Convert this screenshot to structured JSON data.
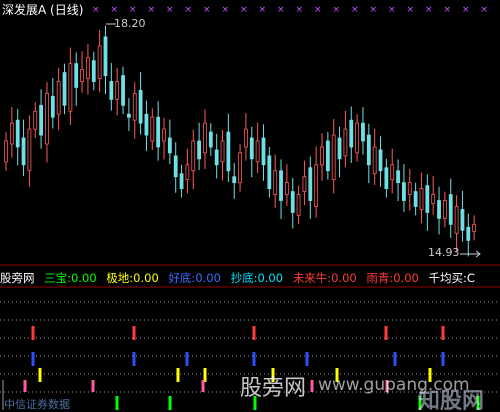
{
  "chart_title": "深发展A (日线)",
  "price_labels": {
    "high": "18.20",
    "low": "14.93"
  },
  "indicator_bar": {
    "name": "股旁网",
    "items": [
      {
        "label": "三宝:",
        "value": "0.00",
        "color": "#00ff00"
      },
      {
        "label": "极地:",
        "value": "0.00",
        "color": "#ffff00"
      },
      {
        "label": "好底:",
        "value": "0.00",
        "color": "#3a6cff"
      },
      {
        "label": "抄底:",
        "value": "0.00",
        "color": "#00e5ff"
      },
      {
        "label": "未来牛:",
        "value": "0.00",
        "color": "#ff3a3a"
      },
      {
        "label": "雨青:",
        "value": "0.00",
        "color": "#ff3a3a"
      },
      {
        "label": "千均买:",
        "value": "C",
        "color": "#ffffff"
      }
    ]
  },
  "watermark": {
    "cn": "股旁网",
    "url": "www.gupang.com",
    "logo": "知股网"
  },
  "bottom_text": "中信证券数据",
  "chart_data": {
    "type": "candlestick",
    "closes": [
      16.6,
      16.9,
      16.5,
      16.2,
      16.8,
      17.1,
      16.7,
      17.4,
      17.0,
      17.6,
      17.2,
      17.9,
      17.5,
      17.8,
      18.0,
      17.6,
      18.2,
      17.7,
      17.3,
      17.6,
      17.2,
      17.0,
      17.4,
      16.9,
      16.7,
      17.0,
      16.5,
      16.8,
      16.4,
      16.0,
      15.8,
      16.2,
      16.6,
      16.3,
      16.9,
      16.5,
      16.2,
      16.6,
      16.1,
      15.9,
      16.4,
      16.8,
      16.3,
      16.6,
      16.2,
      15.8,
      16.1,
      15.6,
      15.9,
      15.4,
      15.7,
      16.0,
      15.6,
      16.2,
      16.5,
      16.1,
      16.7,
      16.3,
      16.8,
      16.5,
      16.9,
      16.6,
      16.2,
      16.5,
      16.1,
      15.8,
      16.2,
      15.9,
      15.6,
      15.9,
      15.5,
      15.8,
      15.4,
      15.7,
      15.3,
      15.6,
      15.2,
      15.5,
      15.1,
      14.93,
      15.2
    ],
    "high": 18.2,
    "low": 14.93
  },
  "signals": [
    {
      "row": "red",
      "color": "#ff3a3a",
      "x": [
        33,
        134,
        254,
        386,
        443
      ]
    },
    {
      "row": "blue",
      "color": "#2a50ff",
      "x": [
        33,
        134,
        187,
        254,
        307,
        395,
        443
      ]
    },
    {
      "row": "yellow",
      "color": "#ffff00",
      "x": [
        40,
        178,
        205,
        273,
        337,
        430
      ]
    },
    {
      "row": "pink",
      "color": "#ff5aa0",
      "x": [
        25,
        93,
        203,
        312,
        387
      ]
    },
    {
      "row": "green",
      "color": "#00ff00",
      "x": [
        117,
        170,
        255,
        420,
        478
      ]
    }
  ],
  "top_markers": "× × × × × × × × × × ×"
}
